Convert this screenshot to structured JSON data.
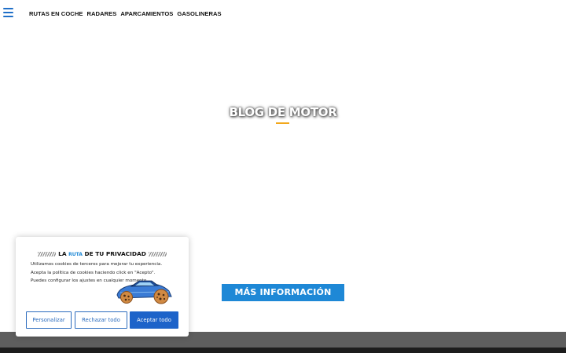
{
  "header": {
    "nav": [
      {
        "label": "RUTAS EN COCHE"
      },
      {
        "label": "RADARES"
      },
      {
        "label": "APARCAMIENTOS"
      },
      {
        "label": "GASOLINERAS"
      }
    ]
  },
  "hero": {
    "title": "BLOG DE MOTOR",
    "underline_color": "#f2a71b",
    "cta_label": "MÁS INFORMACIÓN"
  },
  "cookie_banner": {
    "title_prefix": "LA",
    "title_accent": "RUTA",
    "title_suffix": "DE TU PRIVACIDAD",
    "lines": [
      "Utilizamos cookies de terceros para mejorar tu experiencia.",
      "Acepta la política de cookies haciendo click en \"Acepto\".",
      "Puedes configurar los ajustes en cualquier momento."
    ],
    "buttons": {
      "customize": "Personalizar",
      "reject": "Rechazar todo",
      "accept": "Aceptar todo"
    },
    "illustration": "car-with-cookie-wheels"
  },
  "colors": {
    "accent_blue": "#1e88d6",
    "button_blue": "#1d63c9",
    "footer_gray": "#5e5e5e"
  },
  "icons": {
    "menu": "hamburger-menu-icon"
  }
}
